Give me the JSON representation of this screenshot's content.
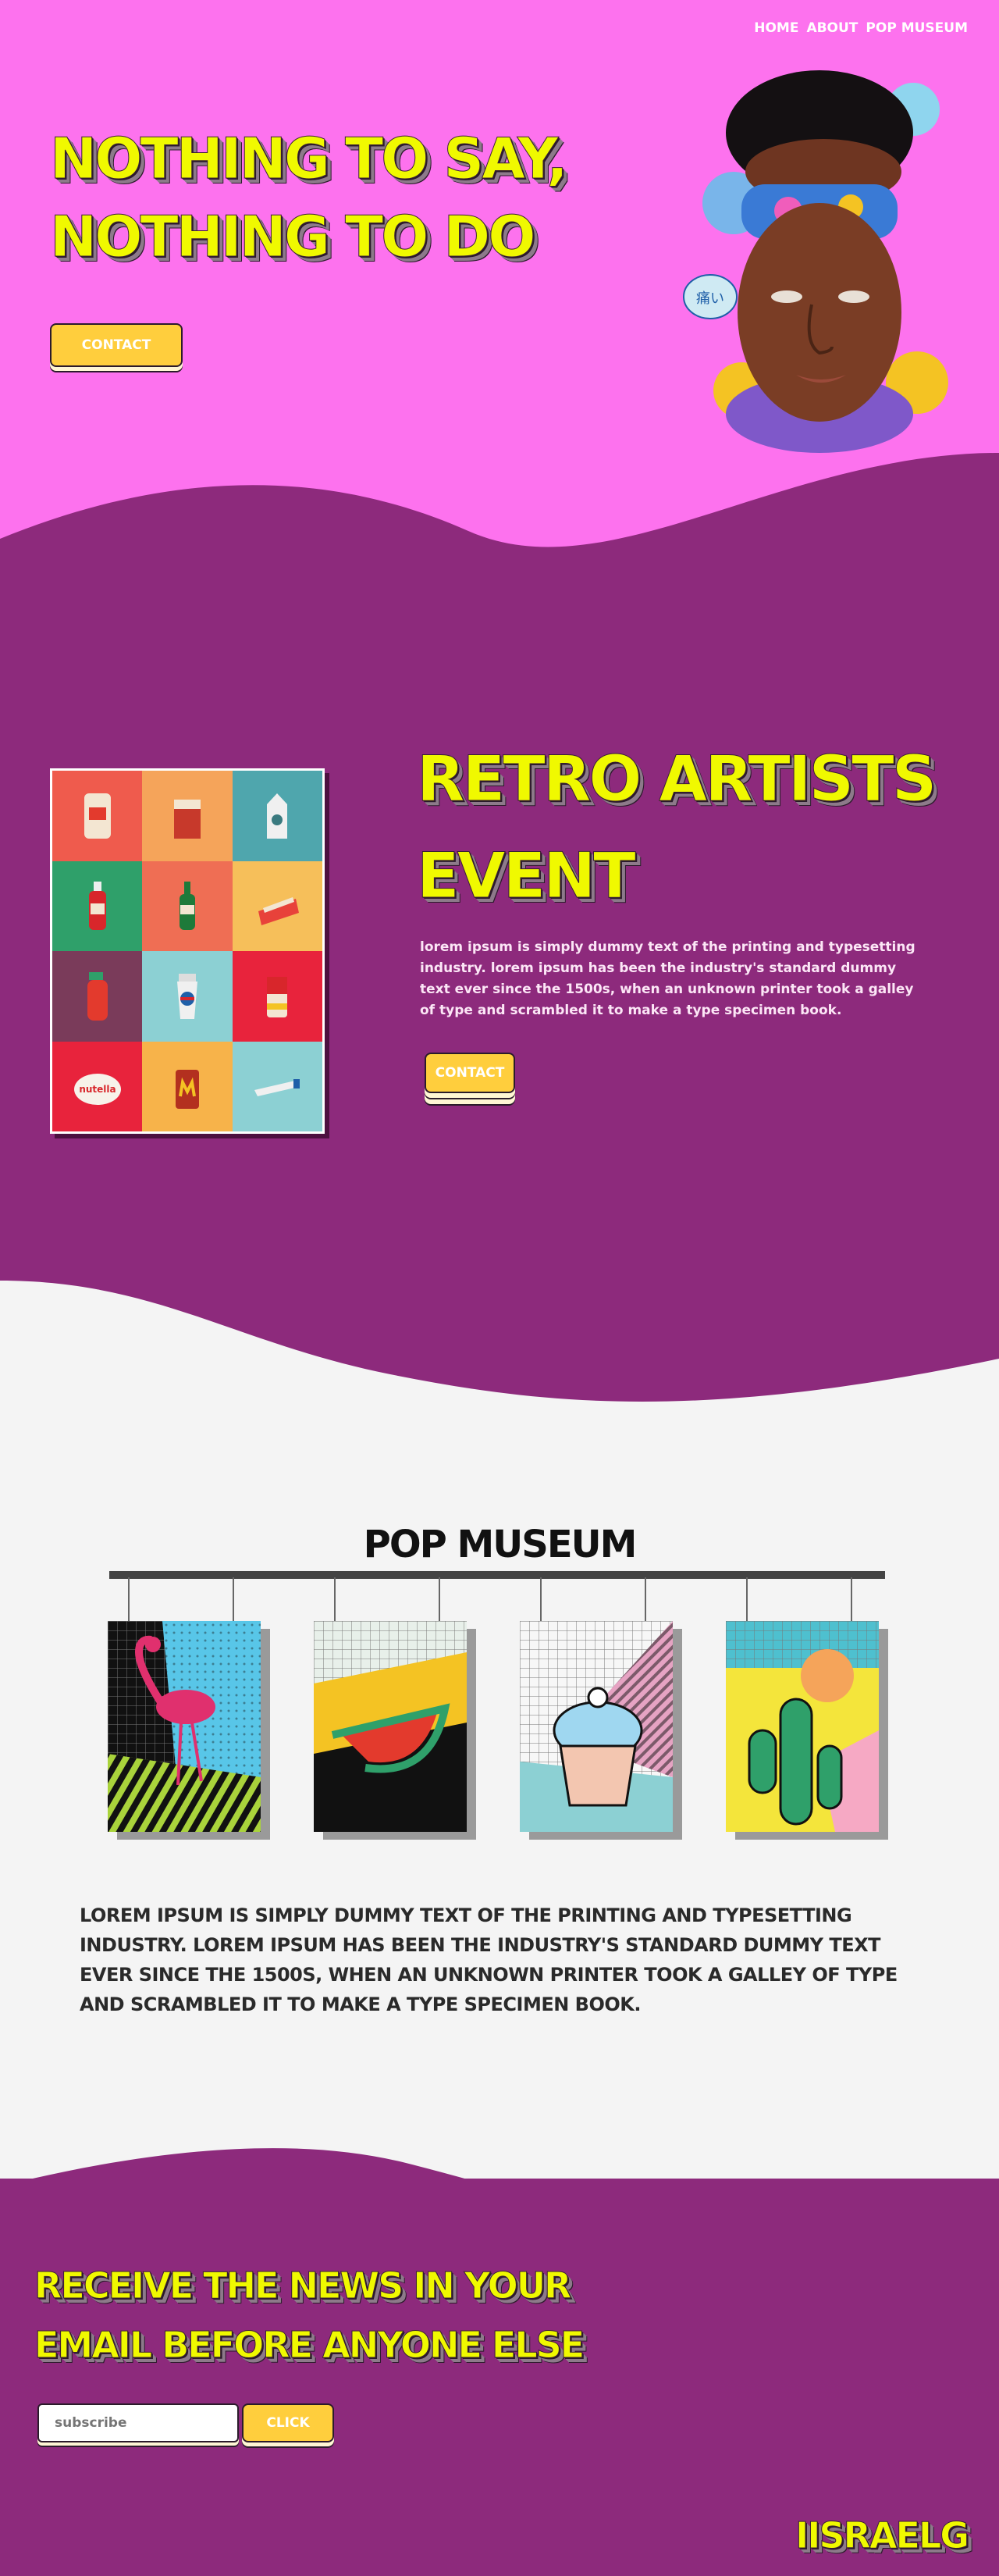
{
  "nav": {
    "items": [
      "HOME",
      "ABOUT",
      "POP MUSEUM"
    ]
  },
  "hero": {
    "title_line1": "NOTHING TO SAY,",
    "title_line2": "NOTHING TO DO",
    "contact_label": "CONTACT"
  },
  "event": {
    "title_line1": "RETRO ARTISTS",
    "title_line2": "EVENT",
    "body": "lorem ipsum is simply dummy text of the printing and typesetting industry. lorem ipsum has been the industry's standard dummy text ever since the 1500s, when an unknown printer took a galley of type and scrambled it to make a type specimen book.",
    "contact_label": "CONTACT",
    "grid_items": [
      {
        "icon": "chips-bag-icon",
        "bg": "#ef5b4d"
      },
      {
        "icon": "cigarette-pack-icon",
        "bg": "#f5a45a"
      },
      {
        "icon": "milk-carton-icon",
        "bg": "#4fa6ad"
      },
      {
        "icon": "ketchup-bottle-icon",
        "bg": "#2fa06a"
      },
      {
        "icon": "beer-bottle-icon",
        "bg": "#ef6e54"
      },
      {
        "icon": "fries-box-icon",
        "bg": "#f6bf5a"
      },
      {
        "icon": "spray-bottle-icon",
        "bg": "#7a3b5a"
      },
      {
        "icon": "soda-cup-icon",
        "bg": "#8cd0d3"
      },
      {
        "icon": "soup-can-icon",
        "bg": "#e8233c"
      },
      {
        "icon": "nutella-jar-icon",
        "bg": "#e8233c"
      },
      {
        "icon": "fast-food-bag-icon",
        "bg": "#f7b34a"
      },
      {
        "icon": "toothpaste-icon",
        "bg": "#8cd0d3"
      }
    ],
    "grid_labels": {
      "nutella": "nutella"
    }
  },
  "museum": {
    "heading": "POP MUSEUM",
    "body": "LOREM IPSUM IS SIMPLY DUMMY TEXT OF THE PRINTING AND TYPESETTING INDUSTRY. LOREM IPSUM HAS BEEN THE INDUSTRY'S STANDARD DUMMY TEXT EVER SINCE THE 1500S, WHEN AN UNKNOWN PRINTER TOOK A GALLEY OF TYPE AND SCRAMBLED IT TO MAKE A TYPE SPECIMEN BOOK.",
    "posters": [
      "flamingo-poster",
      "watermelon-poster",
      "cupcake-poster",
      "cactus-poster"
    ]
  },
  "news": {
    "title_line1": "RECEIVE THE NEWS IN YOUR",
    "title_line2": "EMAIL BEFORE ANYONE ELSE",
    "input_placeholder": "subscribe",
    "button_label": "CLICK"
  },
  "footer": {
    "logo": "IISRAELG"
  },
  "colors": {
    "hero_bg": "#fd72ee",
    "purple": "#8d2a7c",
    "title_yellow": "#f0f900",
    "button_yellow": "#ffce3d",
    "light_bg": "#f4f4f4"
  }
}
